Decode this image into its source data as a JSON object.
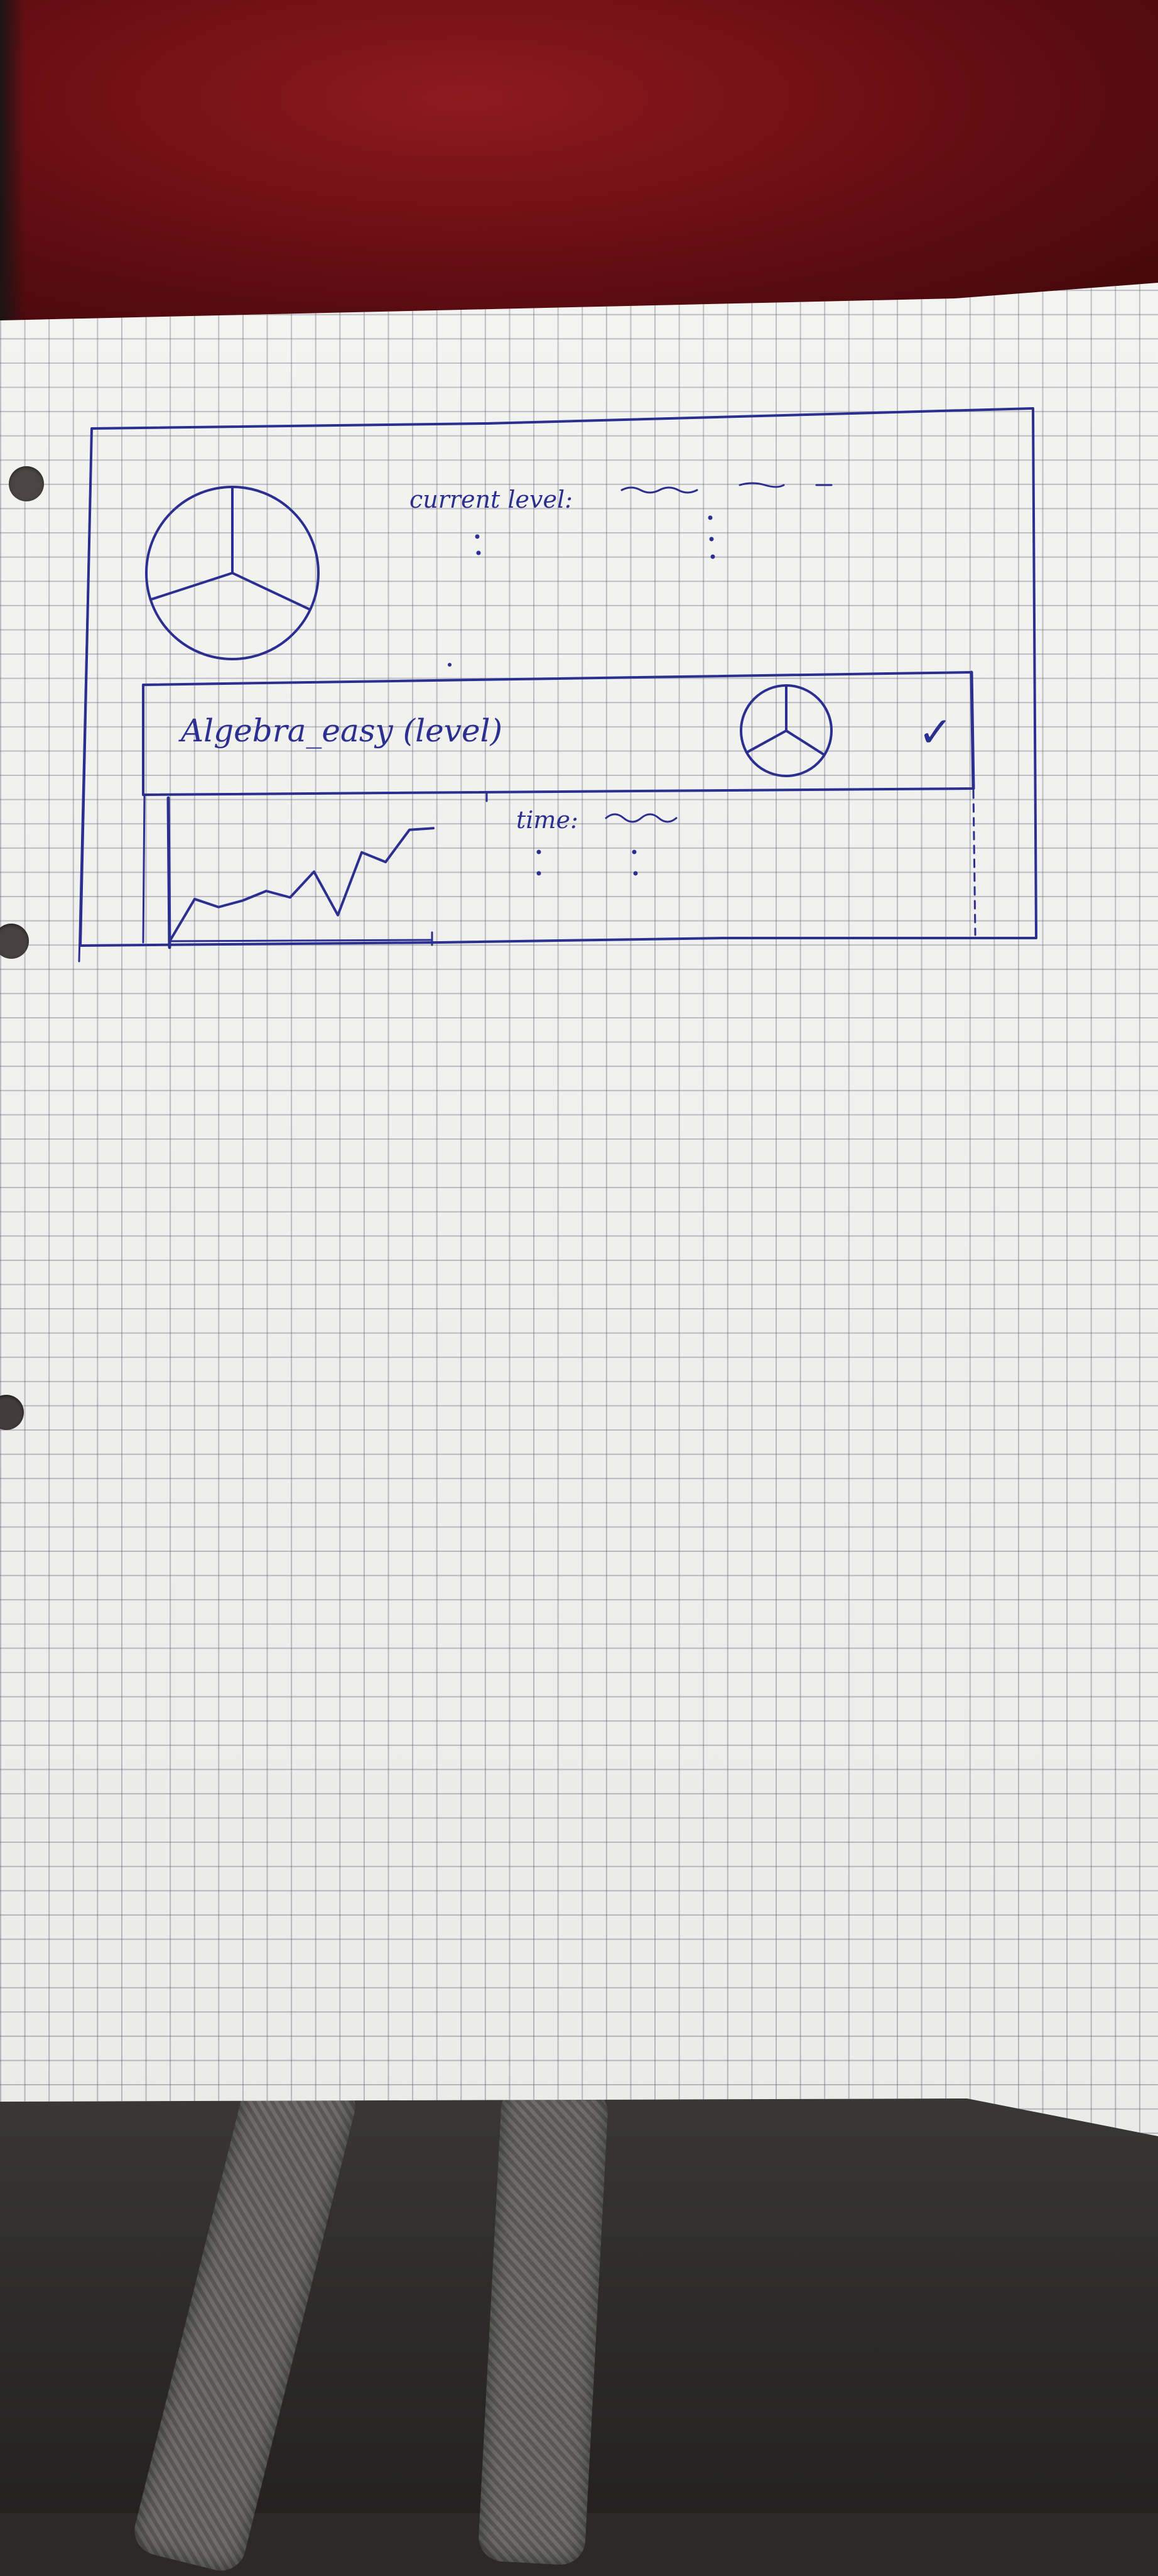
{
  "sketch": {
    "current_level_label": "current level:",
    "row_title": "Algebra_easy (level)",
    "time_label": "time:",
    "check_mark": "✓"
  },
  "chart_data": {
    "type": "line",
    "title": "",
    "xlabel": "",
    "ylabel": "",
    "x": [
      0,
      1,
      2,
      3,
      4,
      5,
      6,
      7,
      8,
      9,
      10,
      11
    ],
    "y": [
      0,
      2.5,
      2,
      2.4,
      3,
      2.6,
      4.2,
      1.5,
      5.4,
      4.8,
      6.8,
      6.9
    ],
    "ylim": [
      0,
      8
    ],
    "grid": false
  },
  "pies": {
    "large": {
      "values": [
        32,
        38,
        30
      ]
    },
    "small": {
      "values": [
        34,
        33,
        33
      ]
    }
  },
  "colors": {
    "ink": "#2b2f8f",
    "paper": "#f3f3f1",
    "grid": "#5a5a6e"
  }
}
